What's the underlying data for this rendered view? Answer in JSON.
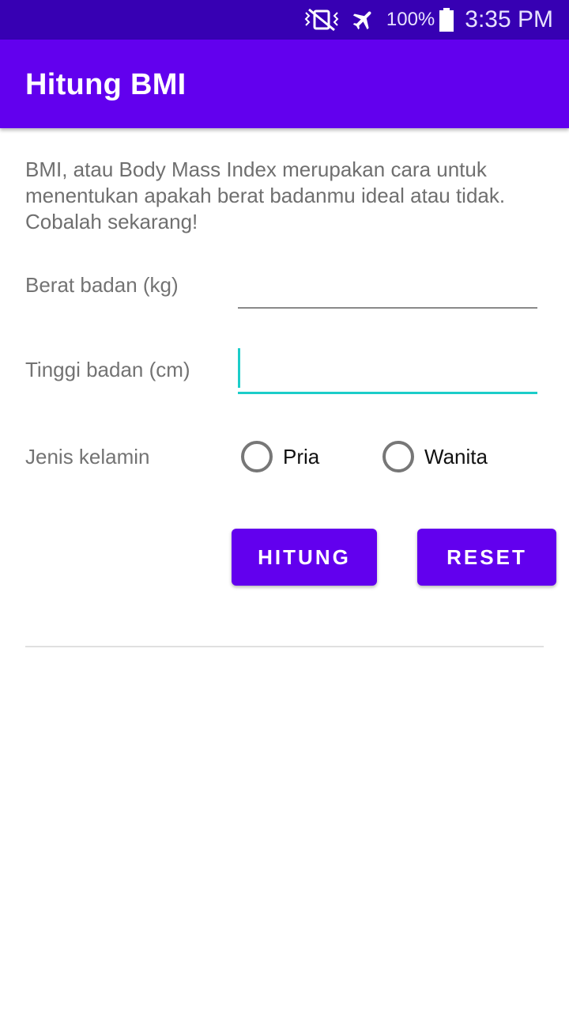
{
  "status_bar": {
    "battery_percent": "100%",
    "time": "3:35 PM",
    "icons": [
      "vibrate-mute-icon",
      "airplane-mode-icon",
      "battery-icon"
    ]
  },
  "app_bar": {
    "title": "Hitung BMI"
  },
  "intro_text": "BMI, atau Body Mass Index merupakan cara untuk menentukan apakah berat badanmu ideal atau tidak. Cobalah sekarang!",
  "form": {
    "weight": {
      "label": "Berat badan (kg)",
      "value": ""
    },
    "height": {
      "label": "Tinggi badan (cm)",
      "value": ""
    },
    "gender": {
      "label": "Jenis kelamin",
      "options": [
        {
          "label": "Pria",
          "selected": false
        },
        {
          "label": "Wanita",
          "selected": false
        }
      ]
    }
  },
  "buttons": {
    "calculate_label": "HITUNG",
    "reset_label": "RESET"
  },
  "colors": {
    "status_bar": "#3700b3",
    "primary": "#6200ee",
    "accent": "#1ccdc9"
  }
}
